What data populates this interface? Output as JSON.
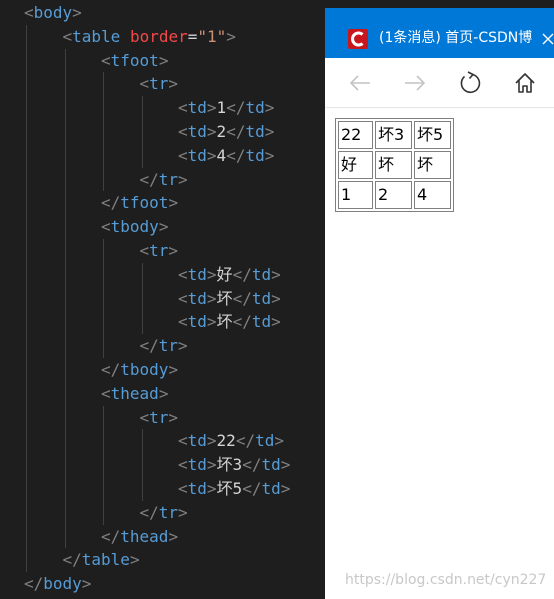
{
  "editor": {
    "lines": [
      {
        "indent": 0,
        "kind": "open",
        "tag": "body"
      },
      {
        "indent": 1,
        "kind": "open_attr",
        "tag": "table",
        "attr": "border",
        "eq": "=",
        "value": "\"1\""
      },
      {
        "indent": 2,
        "kind": "open",
        "tag": "tfoot"
      },
      {
        "indent": 3,
        "kind": "open",
        "tag": "tr"
      },
      {
        "indent": 4,
        "kind": "cell",
        "tag": "td",
        "text": "1"
      },
      {
        "indent": 4,
        "kind": "cell",
        "tag": "td",
        "text": "2"
      },
      {
        "indent": 4,
        "kind": "cell",
        "tag": "td",
        "text": "4"
      },
      {
        "indent": 3,
        "kind": "close",
        "tag": "tr"
      },
      {
        "indent": 2,
        "kind": "close",
        "tag": "tfoot"
      },
      {
        "indent": 2,
        "kind": "open",
        "tag": "tbody"
      },
      {
        "indent": 3,
        "kind": "open",
        "tag": "tr"
      },
      {
        "indent": 4,
        "kind": "cell",
        "tag": "td",
        "text": "好"
      },
      {
        "indent": 4,
        "kind": "cell",
        "tag": "td",
        "text": "坏"
      },
      {
        "indent": 4,
        "kind": "cell",
        "tag": "td",
        "text": "坏"
      },
      {
        "indent": 3,
        "kind": "close",
        "tag": "tr"
      },
      {
        "indent": 2,
        "kind": "close",
        "tag": "tbody"
      },
      {
        "indent": 2,
        "kind": "open",
        "tag": "thead"
      },
      {
        "indent": 3,
        "kind": "open",
        "tag": "tr"
      },
      {
        "indent": 4,
        "kind": "cell",
        "tag": "td",
        "text": "22"
      },
      {
        "indent": 4,
        "kind": "cell",
        "tag": "td",
        "text": "坏3"
      },
      {
        "indent": 4,
        "kind": "cell",
        "tag": "td",
        "text": "坏5"
      },
      {
        "indent": 3,
        "kind": "close",
        "tag": "tr"
      },
      {
        "indent": 2,
        "kind": "close",
        "tag": "thead"
      },
      {
        "indent": 1,
        "kind": "close",
        "tag": "table"
      },
      {
        "indent": 0,
        "kind": "close",
        "tag": "body"
      }
    ]
  },
  "browser": {
    "window_title": "(1条消息) 首页-CSDN博",
    "app_icon": "csdn-logo",
    "close_icon": "close-icon",
    "toolbar_icons": [
      "back-arrow-icon",
      "forward-arrow-icon",
      "refresh-icon",
      "home-icon"
    ],
    "table": {
      "rows": [
        [
          "22",
          "坏3",
          "坏5"
        ],
        [
          "好",
          "坏",
          "坏"
        ],
        [
          "1",
          "2",
          "4"
        ]
      ]
    },
    "watermark": "https://blog.csdn.net/cyn227"
  },
  "colors": {
    "editor_bg": "#1e1e1e",
    "tag": "#569cd6",
    "attr": "#f44747",
    "string": "#ce9178",
    "titlebar": "#0078d7",
    "csdn_red": "#c8161d"
  }
}
